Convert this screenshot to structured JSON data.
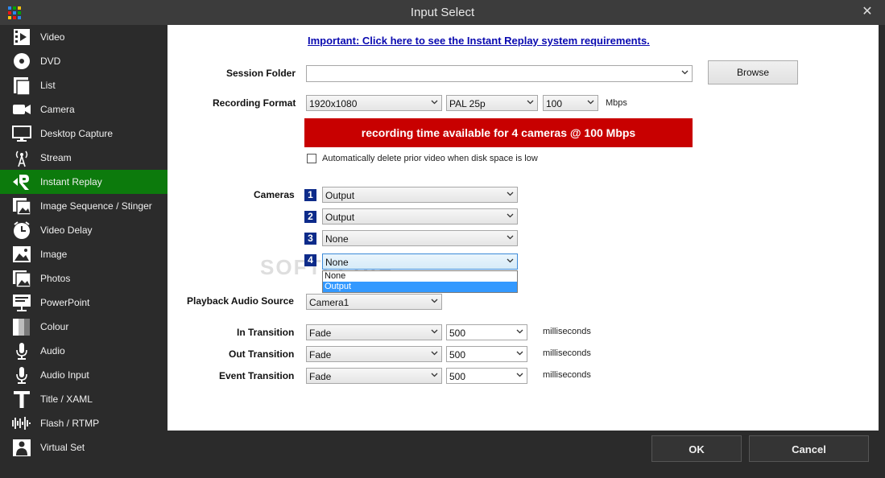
{
  "window": {
    "title": "Input Select",
    "close_glyph": "✕",
    "icon_colors": [
      "#2d89ef",
      "#00a300",
      "#ffc40d",
      "#ee1111",
      "#2d89ef",
      "#00a300",
      "#ffc40d",
      "#ee1111",
      "#2d89ef"
    ]
  },
  "sidebar": {
    "active_color": "#0c7a0c",
    "items": [
      {
        "label": "Video",
        "icon": "film-icon"
      },
      {
        "label": "DVD",
        "icon": "disc-icon"
      },
      {
        "label": "List",
        "icon": "list-icon"
      },
      {
        "label": "Camera",
        "icon": "camera-icon"
      },
      {
        "label": "Desktop Capture",
        "icon": "monitor-icon"
      },
      {
        "label": "Stream",
        "icon": "broadcast-tower-icon"
      },
      {
        "label": "Instant Replay",
        "icon": "replay-icon",
        "active": true
      },
      {
        "label": "Image Sequence / Stinger",
        "icon": "image-stack-icon"
      },
      {
        "label": "Video Delay",
        "icon": "clock-icon"
      },
      {
        "label": "Image",
        "icon": "image-icon"
      },
      {
        "label": "Photos",
        "icon": "photos-icon"
      },
      {
        "label": "PowerPoint",
        "icon": "presentation-icon"
      },
      {
        "label": "Colour",
        "icon": "colour-bars-icon"
      },
      {
        "label": "Audio",
        "icon": "microphone-icon"
      },
      {
        "label": "Audio Input",
        "icon": "microphone-icon"
      },
      {
        "label": "Title / XAML",
        "icon": "text-t-icon"
      },
      {
        "label": "Flash / RTMP",
        "icon": "waveform-icon"
      },
      {
        "label": "Virtual Set",
        "icon": "person-icon"
      }
    ]
  },
  "main": {
    "requirements_link": "Important: Click here to see the Instant Replay system requirements.",
    "session_folder": {
      "label": "Session Folder",
      "value": "",
      "browse_label": "Browse"
    },
    "recording_format": {
      "label": "Recording Format",
      "resolution": "1920x1080",
      "frame_rate": "PAL 25p",
      "bitrate": "100",
      "bitrate_unit": "Mbps"
    },
    "recording_banner": "recording time available for 4 cameras @ 100 Mbps",
    "banner_color": "#c80000",
    "auto_delete": {
      "label": "Automatically delete prior video when disk space is low",
      "checked": false
    },
    "cameras": {
      "label": "Cameras",
      "rows": [
        {
          "number": "1",
          "value": "Output"
        },
        {
          "number": "2",
          "value": "Output"
        },
        {
          "number": "3",
          "value": "None"
        },
        {
          "number": "4",
          "value": "None"
        }
      ],
      "open_dropdown_options": [
        {
          "label": "None",
          "selected": false
        },
        {
          "label": "Output",
          "selected": true
        }
      ]
    },
    "playback_audio_source": {
      "label": "Playback Audio Source",
      "value": "Camera1"
    },
    "transitions": [
      {
        "label": "In Transition",
        "effect": "Fade",
        "duration": "500",
        "unit": "milliseconds"
      },
      {
        "label": "Out Transition",
        "effect": "Fade",
        "duration": "500",
        "unit": "milliseconds"
      },
      {
        "label": "Event Transition",
        "effect": "Fade",
        "duration": "500",
        "unit": "milliseconds"
      }
    ],
    "watermark": "SOFTPEDIA"
  },
  "footer": {
    "ok_label": "OK",
    "cancel_label": "Cancel"
  }
}
